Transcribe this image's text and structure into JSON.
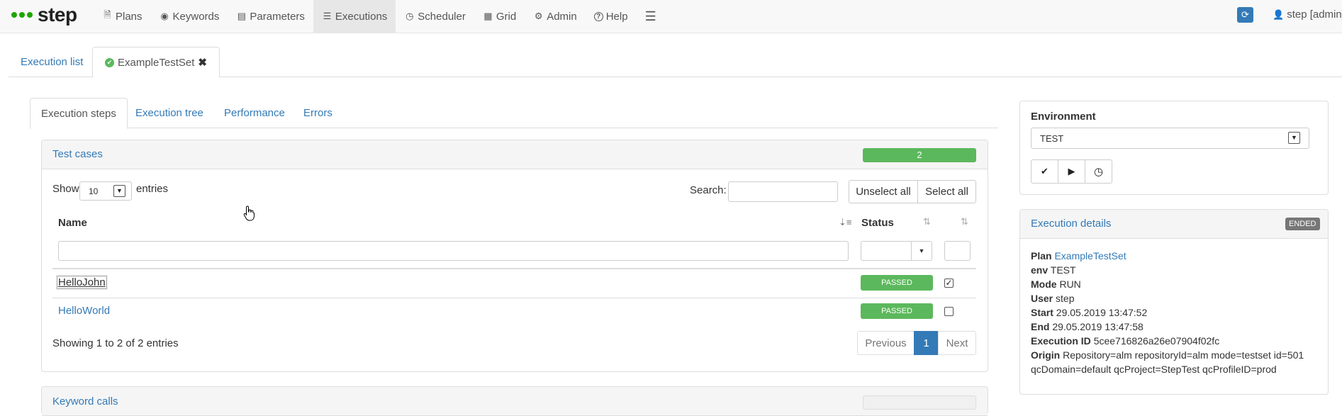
{
  "brand": {
    "name": "step"
  },
  "nav": {
    "items": [
      {
        "label": "Plans",
        "icon": "file-icon",
        "glyph": "🗎"
      },
      {
        "label": "Keywords",
        "icon": "record-icon",
        "glyph": "◉"
      },
      {
        "label": "Parameters",
        "icon": "list-alt-icon",
        "glyph": "▤"
      },
      {
        "label": "Executions",
        "icon": "tasks-icon",
        "glyph": "☰"
      },
      {
        "label": "Scheduler",
        "icon": "clock-icon",
        "glyph": "◷"
      },
      {
        "label": "Grid",
        "icon": "th-icon",
        "glyph": "▦"
      },
      {
        "label": "Admin",
        "icon": "cog-icon",
        "glyph": "⚙"
      },
      {
        "label": "Help",
        "icon": "question-icon",
        "glyph": "?"
      }
    ],
    "active": "Executions",
    "user": "step [admin]"
  },
  "outer_tabs": {
    "execution_list": "Execution list",
    "current": "ExampleTestSet"
  },
  "inner_tabs": [
    "Execution steps",
    "Execution tree",
    "Performance",
    "Errors"
  ],
  "test_cases": {
    "title": "Test cases",
    "count": "2",
    "show_label": "Show",
    "entries_value": "10",
    "entries_label": "entries",
    "search_label": "Search:",
    "unselect_all": "Unselect all",
    "select_all": "Select all",
    "columns": {
      "name": "Name",
      "status": "Status"
    },
    "rows": [
      {
        "name": "HelloJohn",
        "status": "PASSED",
        "checked": true
      },
      {
        "name": "HelloWorld",
        "status": "PASSED",
        "checked": false
      }
    ],
    "info": "Showing 1 to 2 of 2 entries",
    "pagination": {
      "previous": "Previous",
      "page": "1",
      "next": "Next"
    }
  },
  "keyword_calls": {
    "title": "Keyword calls"
  },
  "environment": {
    "label": "Environment",
    "value": "TEST"
  },
  "details": {
    "title": "Execution details",
    "state": "ENDED",
    "plan_label": "Plan",
    "plan_value": "ExampleTestSet",
    "env_label": "env",
    "env_value": "TEST",
    "mode_label": "Mode",
    "mode_value": "RUN",
    "user_label": "User",
    "user_value": "step",
    "start_label": "Start",
    "start_value": "29.05.2019 13:47:52",
    "end_label": "End",
    "end_value": "29.05.2019 13:47:58",
    "id_label": "Execution ID",
    "id_value": "5cee716826a26e07904f02fc",
    "origin_label": "Origin",
    "origin_value": "Repository=alm repositoryId=alm mode=testset id=501",
    "origin_value2": "qcDomain=default qcProject=StepTest qcProfileID=prod"
  },
  "colors": {
    "link": "#337ab7",
    "success": "#5cb85c",
    "brand_green": "#1fa400",
    "badge_gray": "#777777"
  }
}
